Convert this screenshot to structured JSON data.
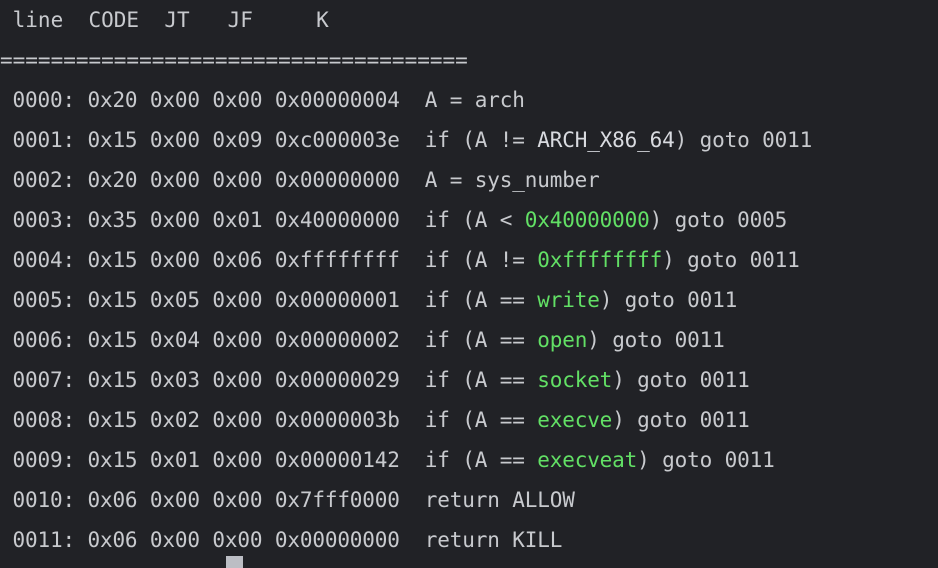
{
  "terminal": {
    "background_color": "#212226",
    "foreground_color": "#c8cace",
    "accent_green": "#62e065",
    "cursor_color": "#bcbec4"
  },
  "header": {
    "raw": " line  CODE  JT   JF     K",
    "columns": [
      "line",
      "CODE",
      "JT",
      "JF",
      "K"
    ],
    "separator": "====================================="
  },
  "instructions": [
    {
      "line": "0000:",
      "code": "0x20",
      "jt": "0x00",
      "jf": "0x00",
      "k": "0x00000004",
      "comment_segments": [
        {
          "text": "A = arch",
          "style": "plain"
        }
      ]
    },
    {
      "line": "0001:",
      "code": "0x15",
      "jt": "0x00",
      "jf": "0x09",
      "k": "0xc000003e",
      "comment_segments": [
        {
          "text": "if (A != ",
          "style": "plain"
        },
        {
          "text": "ARCH_X86_64",
          "style": "light"
        },
        {
          "text": ") goto 0011",
          "style": "plain"
        }
      ]
    },
    {
      "line": "0002:",
      "code": "0x20",
      "jt": "0x00",
      "jf": "0x00",
      "k": "0x00000000",
      "comment_segments": [
        {
          "text": "A = sys_number",
          "style": "plain"
        }
      ]
    },
    {
      "line": "0003:",
      "code": "0x35",
      "jt": "0x00",
      "jf": "0x01",
      "k": "0x40000000",
      "comment_segments": [
        {
          "text": "if (A < ",
          "style": "plain"
        },
        {
          "text": "0x40000000",
          "style": "green"
        },
        {
          "text": ") goto 0005",
          "style": "plain"
        }
      ]
    },
    {
      "line": "0004:",
      "code": "0x15",
      "jt": "0x00",
      "jf": "0x06",
      "k": "0xffffffff",
      "comment_segments": [
        {
          "text": "if (A != ",
          "style": "plain"
        },
        {
          "text": "0xffffffff",
          "style": "green"
        },
        {
          "text": ") goto 0011",
          "style": "plain"
        }
      ]
    },
    {
      "line": "0005:",
      "code": "0x15",
      "jt": "0x05",
      "jf": "0x00",
      "k": "0x00000001",
      "comment_segments": [
        {
          "text": "if (A == ",
          "style": "plain"
        },
        {
          "text": "write",
          "style": "green"
        },
        {
          "text": ") goto 0011",
          "style": "plain"
        }
      ]
    },
    {
      "line": "0006:",
      "code": "0x15",
      "jt": "0x04",
      "jf": "0x00",
      "k": "0x00000002",
      "comment_segments": [
        {
          "text": "if (A == ",
          "style": "plain"
        },
        {
          "text": "open",
          "style": "green"
        },
        {
          "text": ") goto 0011",
          "style": "plain"
        }
      ]
    },
    {
      "line": "0007:",
      "code": "0x15",
      "jt": "0x03",
      "jf": "0x00",
      "k": "0x00000029",
      "comment_segments": [
        {
          "text": "if (A == ",
          "style": "plain"
        },
        {
          "text": "socket",
          "style": "green"
        },
        {
          "text": ") goto 0011",
          "style": "plain"
        }
      ]
    },
    {
      "line": "0008:",
      "code": "0x15",
      "jt": "0x02",
      "jf": "0x00",
      "k": "0x0000003b",
      "comment_segments": [
        {
          "text": "if (A == ",
          "style": "plain"
        },
        {
          "text": "execve",
          "style": "green"
        },
        {
          "text": ") goto 0011",
          "style": "plain"
        }
      ]
    },
    {
      "line": "0009:",
      "code": "0x15",
      "jt": "0x01",
      "jf": "0x00",
      "k": "0x00000142",
      "comment_segments": [
        {
          "text": "if (A == ",
          "style": "plain"
        },
        {
          "text": "execveat",
          "style": "green"
        },
        {
          "text": ") goto 0011",
          "style": "plain"
        }
      ]
    },
    {
      "line": "0010:",
      "code": "0x06",
      "jt": "0x00",
      "jf": "0x00",
      "k": "0x7fff0000",
      "comment_segments": [
        {
          "text": "return ALLOW",
          "style": "plain"
        }
      ]
    },
    {
      "line": "0011:",
      "code": "0x06",
      "jt": "0x00",
      "jf": "0x00",
      "k": "0x00000000",
      "comment_segments": [
        {
          "text": "return KILL",
          "style": "plain"
        }
      ]
    }
  ],
  "cursor": {
    "visible": true,
    "glyph": "block"
  }
}
